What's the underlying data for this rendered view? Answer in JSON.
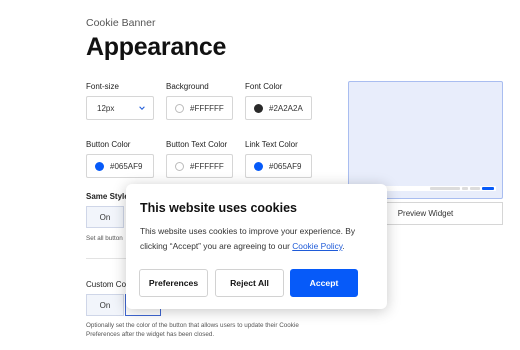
{
  "header": {
    "breadcrumb": "Cookie Banner",
    "title": "Appearance"
  },
  "settings": {
    "font_size": {
      "label": "Font-size",
      "value": "12px"
    },
    "background": {
      "label": "Background",
      "value": "#FFFFFF",
      "swatch_color": "#FFFFFF"
    },
    "font_color": {
      "label": "Font Color",
      "value": "#2A2A2A",
      "swatch_color": "#2A2A2A"
    },
    "button_color": {
      "label": "Button Color",
      "value": "#065AF9",
      "swatch_color": "#065AF9"
    },
    "button_text_color": {
      "label": "Button Text Color",
      "value": "#FFFFFF",
      "swatch_color": "#FFFFFF"
    },
    "link_text_color": {
      "label": "Link Text Color",
      "value": "#065AF9",
      "swatch_color": "#065AF9"
    },
    "same_style": {
      "label": "Same Style",
      "option_on": "On",
      "hint": "Set all button"
    },
    "custom_color": {
      "label": "Custom Co",
      "option_on": "On",
      "hint": "Optionally set the color of the button that allows users to update their Cookie Preferences after the widget has been closed."
    }
  },
  "preview": {
    "button_label": "Preview Widget",
    "mini_labels": [
      "Reject All",
      "Accept"
    ]
  },
  "cookie_modal": {
    "title": "This website uses cookies",
    "body_prefix": "This website uses cookies to improve your experience. By clicking “Accept” you are agreeing to our ",
    "link_text": "Cookie Policy",
    "body_suffix": ".",
    "preferences_label": "Preferences",
    "reject_label": "Reject All",
    "accept_label": "Accept"
  },
  "colors": {
    "accent": "#065AF9",
    "preview_bg": "#e8edfb"
  }
}
